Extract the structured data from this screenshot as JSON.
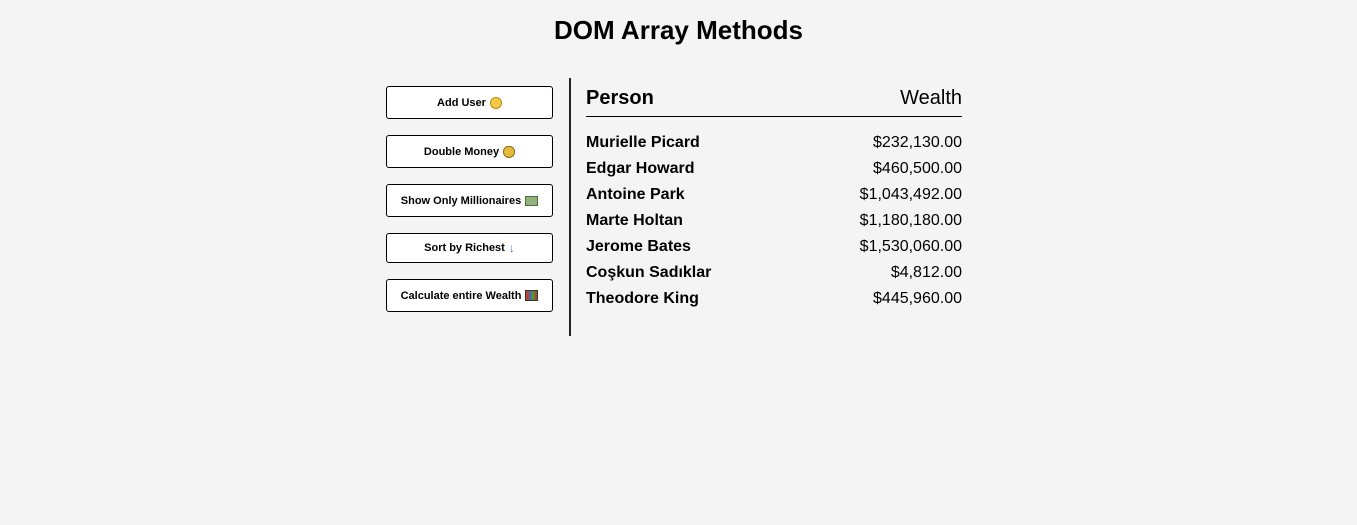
{
  "page": {
    "title": "DOM Array Methods"
  },
  "sidebar": {
    "buttons": [
      {
        "label": "Add User",
        "icon": "man-face-icon"
      },
      {
        "label": "Double Money",
        "icon": "money-bag-icon"
      },
      {
        "label": "Show Only Millionaires",
        "icon": "dollar-bills-icon"
      },
      {
        "label": "Sort by Richest",
        "icon": "down-arrow-icon",
        "glyph": "↓"
      },
      {
        "label": "Calculate entire Wealth",
        "icon": "books-icon"
      }
    ]
  },
  "main": {
    "header": {
      "person": "Person",
      "wealth": "Wealth"
    },
    "people": [
      {
        "name": "Murielle Picard",
        "wealth": "$232,130.00"
      },
      {
        "name": "Edgar Howard",
        "wealth": "$460,500.00"
      },
      {
        "name": "Antoine Park",
        "wealth": "$1,043,492.00"
      },
      {
        "name": "Marte Holtan",
        "wealth": "$1,180,180.00"
      },
      {
        "name": "Jerome Bates",
        "wealth": "$1,530,060.00"
      },
      {
        "name": "Coşkun Sadıklar",
        "wealth": "$4,812.00"
      },
      {
        "name": "Theodore King",
        "wealth": "$445,960.00"
      }
    ]
  },
  "colors": {
    "background": "#f4f4f4",
    "button_background": "#ffffff",
    "border": "#000000"
  }
}
